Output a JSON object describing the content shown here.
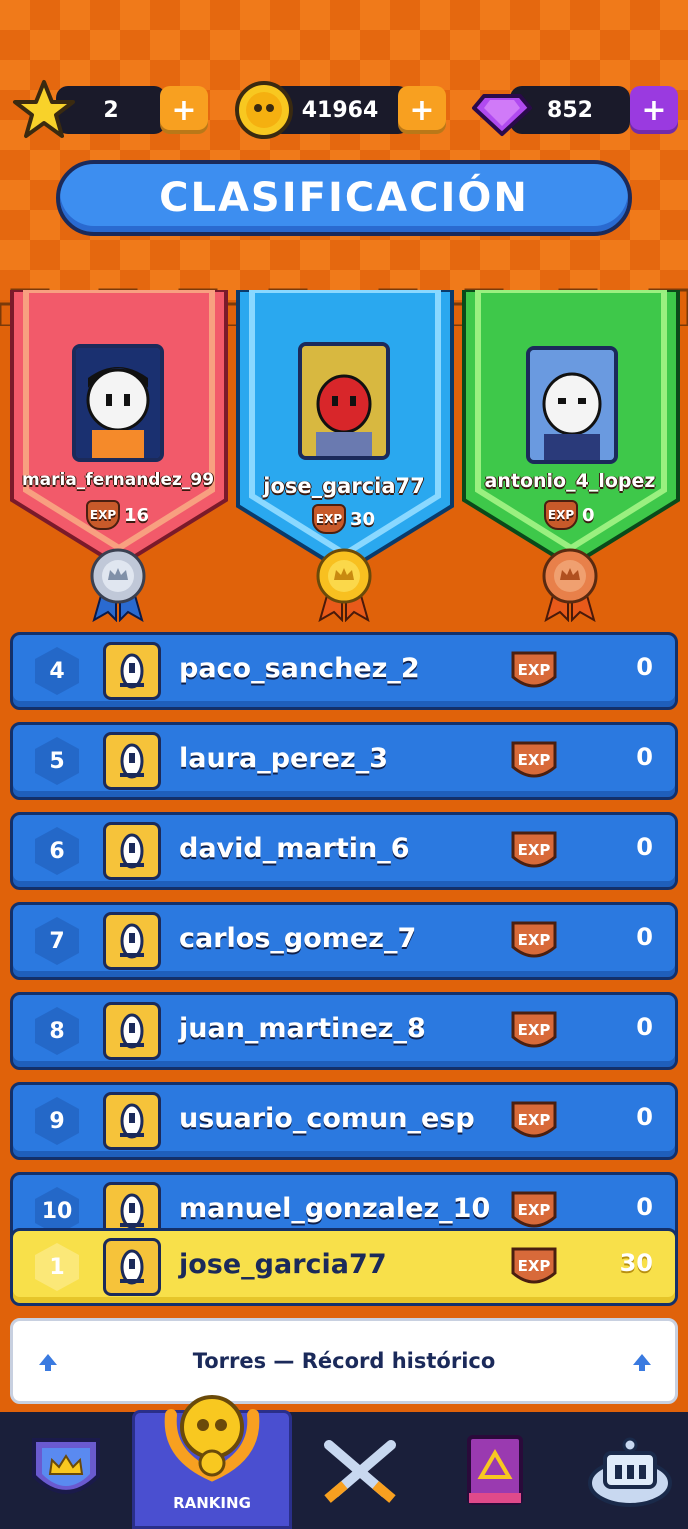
{
  "currency": {
    "stars": "2",
    "coins": "41964",
    "gems": "852",
    "plus_label": "+"
  },
  "title": "CLASIFICACIÓN",
  "podium": [
    {
      "place": "2",
      "name": "maria_fernandez_99",
      "exp_label": "EXP",
      "exp": "16",
      "color": "#f25a6a",
      "medal": "silver"
    },
    {
      "place": "1",
      "name": "jose_garcia77",
      "exp_label": "EXP",
      "exp": "30",
      "color": "#2aa8ef",
      "medal": "gold"
    },
    {
      "place": "3",
      "name": "antonio_4_lopez",
      "exp_label": "EXP",
      "exp": "0",
      "color": "#3ec84a",
      "medal": "bronze"
    }
  ],
  "rows": [
    {
      "rank": "4",
      "name": "paco_sanchez_2",
      "exp_label": "EXP",
      "exp": "0"
    },
    {
      "rank": "5",
      "name": "laura_perez_3",
      "exp_label": "EXP",
      "exp": "0"
    },
    {
      "rank": "6",
      "name": "david_martin_6",
      "exp_label": "EXP",
      "exp": "0"
    },
    {
      "rank": "7",
      "name": "carlos_gomez_7",
      "exp_label": "EXP",
      "exp": "0"
    },
    {
      "rank": "8",
      "name": "juan_martinez_8",
      "exp_label": "EXP",
      "exp": "0"
    },
    {
      "rank": "9",
      "name": "usuario_comun_esp",
      "exp_label": "EXP",
      "exp": "0"
    },
    {
      "rank": "10",
      "name": "manuel_gonzalez_10",
      "exp_label": "EXP",
      "exp": "0"
    }
  ],
  "current_user": {
    "rank": "1",
    "name": "jose_garcia77",
    "exp_label": "EXP",
    "exp": "30"
  },
  "record_bar": "Torres — Récord histórico",
  "nav": {
    "ranking_label": "RANKING",
    "items": [
      "crown-shield-icon",
      "ranking-laurel-icon",
      "crossed-swords-icon",
      "spellbook-icon",
      "castle-tower-icon"
    ]
  },
  "colors": {
    "row_blue": "#2b79e0",
    "highlight_yellow": "#f8e04a",
    "nav_active": "#4a4fd0",
    "title_blue": "#3d8ef0"
  }
}
